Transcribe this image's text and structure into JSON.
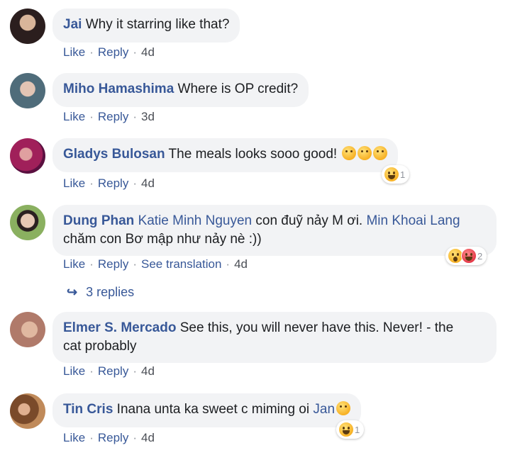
{
  "comments": [
    {
      "author": "Jai",
      "text": " Why it starring like that?",
      "like": "Like",
      "reply": "Reply",
      "time": "4d",
      "avatar_color": "#3a2a2a"
    },
    {
      "author": "Miho Hamashima",
      "text": " Where is OP credit?",
      "like": "Like",
      "reply": "Reply",
      "time": "3d",
      "avatar_color": "#5a6e7a"
    },
    {
      "author": "Gladys Bulosan",
      "text": " The meals looks sooo good! ",
      "emojis": [
        "face-savoring-food-emoji",
        "face-savoring-food-emoji",
        "grinning-sweat-emoji"
      ],
      "reaction_icons": [
        "haha-reaction-icon"
      ],
      "reaction_count": "1",
      "like": "Like",
      "reply": "Reply",
      "time": "4d",
      "avatar_color": "#8a2a5a"
    },
    {
      "author": "Dung Phan",
      "mention1": "Katie Minh Nguyen",
      "text1": " con đuỹ nảy M ơi. ",
      "mention2": "Min Khoai Lang",
      "text2": "chăm con Bơ mập như nảy nè :))",
      "reaction_icons": [
        "wow-reaction-icon",
        "love-reaction-icon"
      ],
      "reaction_count": "2",
      "like": "Like",
      "reply": "Reply",
      "translation": "See translation",
      "time": "4d",
      "avatar_color": "#7aa04a"
    },
    {
      "author": "Elmer S. Mercado",
      "text": " See this, you will never have this. Never! - the",
      "text_line2": "cat probably",
      "like": "Like",
      "reply": "Reply",
      "time": "4d",
      "avatar_color": "#c08a7a"
    },
    {
      "author": "Tin Cris",
      "text": " Inana unta ka sweet c miming oi ",
      "mention": "Jan",
      "emojis": [
        "rolling-laughing-emoji"
      ],
      "reaction_icons": [
        "haha-reaction-icon"
      ],
      "reaction_count": "1",
      "like": "Like",
      "reply": "Reply",
      "time": "4d",
      "avatar_color": "#a07050"
    }
  ],
  "replies_link": "3 replies",
  "colors": {
    "link": "#385898",
    "bubble": "#f2f3f5",
    "text": "#1c1e21",
    "meta": "#90949c"
  }
}
